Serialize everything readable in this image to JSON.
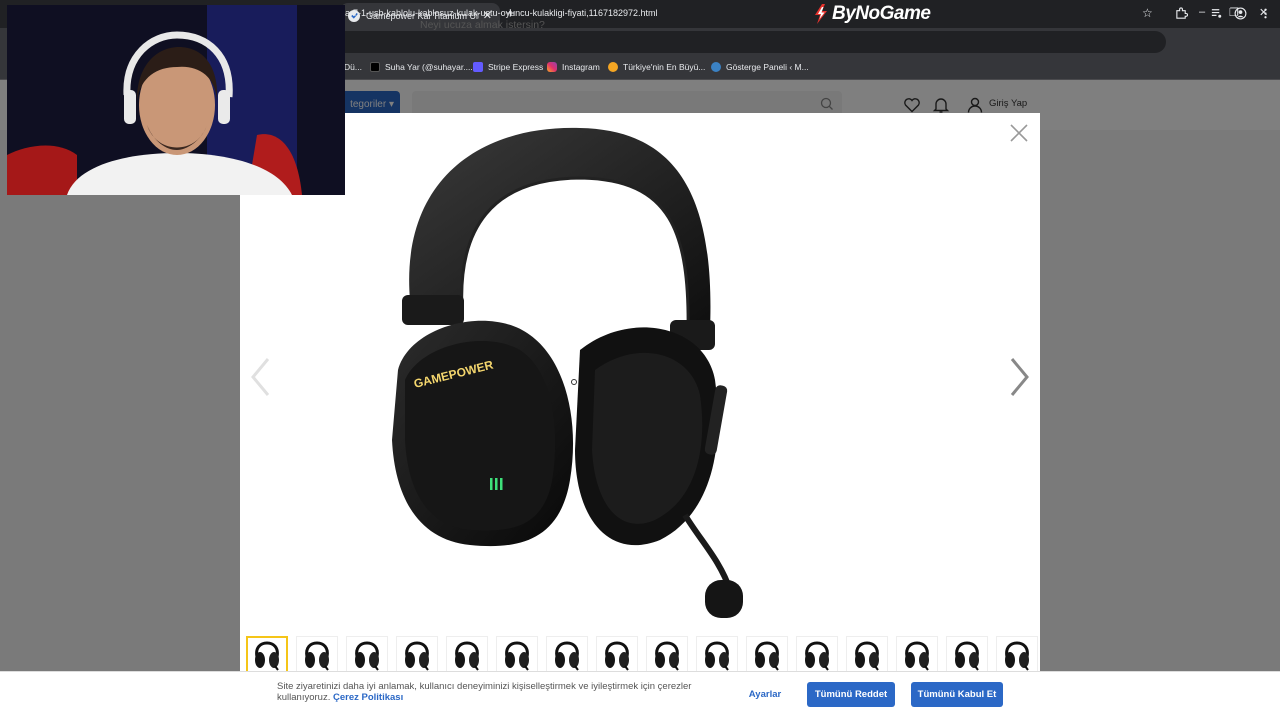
{
  "browser": {
    "tab_title": "Gamepower Kai Titanium Ultra",
    "tab_close": "✕",
    "new_tab": "+",
    "url": "ra-7-1-usb-kablolu-kablosuz-kulak-ustu-oyuncu-kulakligi-fiyati,1167182972.html",
    "brand": "ByNoGame",
    "window_controls": [
      "–",
      "❐",
      "✕"
    ],
    "bookmarks": [
      {
        "label": "Dü...",
        "icon": "folder-icon"
      },
      {
        "label": "Suha Yar (@suhayar....",
        "icon": "tiktok-icon",
        "color": "#000000"
      },
      {
        "label": "Stripe Express",
        "icon": "stripe-icon",
        "color": "#635bff"
      },
      {
        "label": "Instagram",
        "icon": "instagram-icon",
        "color": "#e1306c"
      },
      {
        "label": "Türkiye'nin En Büyü...",
        "icon": "site-icon",
        "color": "#f5a623"
      },
      {
        "label": "Gösterge Paneli ‹ M...",
        "icon": "wordpress-icon",
        "color": "#3b82c4"
      }
    ]
  },
  "site": {
    "categories_label": "tegoriler ▾",
    "search_placeholder": "Neyi ucuza almak istersin?",
    "login_label": "Giriş Yap"
  },
  "lightbox": {
    "thumbnail_count": 16,
    "active_thumbnail_index": 0,
    "product_logo": "GAMEPOWER"
  },
  "cookie": {
    "text": "Site ziyaretinizi daha iyi anlamak, kullanıcı deneyiminizi kişiselleştirmek ve iyileştirmek için çerezler kullanıyoruz.",
    "policy_link": "Çerez Politikası",
    "settings_label": "Ayarlar",
    "reject_label": "Tümünü Reddet",
    "accept_label": "Tümünü Kabul Et"
  },
  "colors": {
    "brand_blue": "#2b68c6",
    "brand_red": "#e5322d",
    "active_thumb": "#f5c518"
  }
}
